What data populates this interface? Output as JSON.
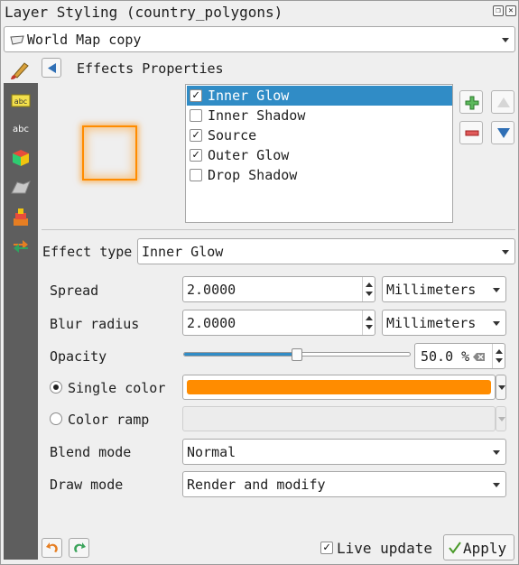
{
  "window": {
    "title": "Layer Styling (country_polygons)"
  },
  "layer_combo": {
    "value": "World Map copy"
  },
  "panel": {
    "title": "Effects Properties"
  },
  "effects_list": [
    {
      "label": "Inner Glow",
      "checked": true,
      "selected": true
    },
    {
      "label": "Inner Shadow",
      "checked": false,
      "selected": false
    },
    {
      "label": "Source",
      "checked": true,
      "selected": false
    },
    {
      "label": "Outer Glow",
      "checked": true,
      "selected": false
    },
    {
      "label": "Drop Shadow",
      "checked": false,
      "selected": false
    }
  ],
  "effect_type": {
    "label": "Effect type",
    "value": "Inner Glow"
  },
  "spread": {
    "label": "Spread",
    "value": "2.0000",
    "unit": "Millimeters"
  },
  "blur": {
    "label": "Blur radius",
    "value": "2.0000",
    "unit": "Millimeters"
  },
  "opacity": {
    "label": "Opacity",
    "value": "50.0 %",
    "fraction": 0.5
  },
  "single_color": {
    "label": "Single color",
    "color": "#ff8c00",
    "selected": true
  },
  "color_ramp": {
    "label": "Color ramp",
    "selected": false
  },
  "blend_mode": {
    "label": "Blend mode",
    "value": "Normal"
  },
  "draw_mode": {
    "label": "Draw mode",
    "value": "Render and modify"
  },
  "footer": {
    "live_update": "Live update",
    "apply": "Apply"
  },
  "colors": {
    "selection": "#308cc6",
    "accent": "#ff8c00",
    "sidebar": "#5e5e5e"
  }
}
